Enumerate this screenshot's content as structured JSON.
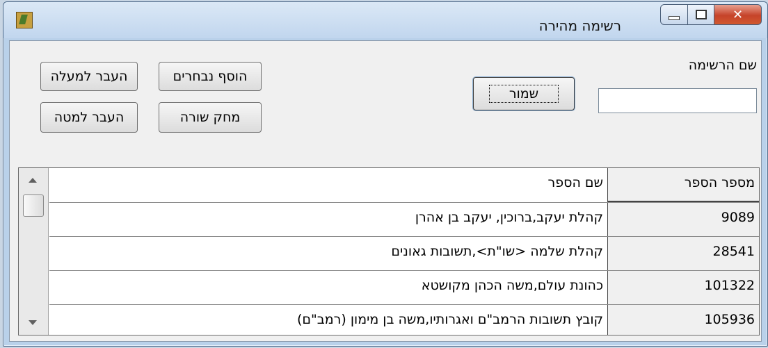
{
  "window": {
    "title": "רשימה מהירה"
  },
  "caption_icons": [
    "minimize-icon",
    "maximize-icon",
    "close-icon"
  ],
  "form": {
    "list_name_label": "שם הרשימה",
    "list_name_value": "",
    "save_button": "שמור",
    "add_selected_button": "הוסף נבחרים",
    "move_up_button": "העבר למעלה",
    "delete_row_button": "מחק שורה",
    "move_down_button": "העבר למטה"
  },
  "table": {
    "columns": [
      "מספר הספר",
      "שם הספר"
    ],
    "rows": [
      {
        "number": "9089",
        "name": "קהלת יעקב,ברוכין, יעקב בן אהרן"
      },
      {
        "number": "28541",
        "name": "קהלת שלמה <שו\"ת>,תשובות גאונים"
      },
      {
        "number": "101322",
        "name": "כהונת עולם,משה הכהן מקושטא"
      },
      {
        "number": "105936",
        "name": "קובץ תשובות הרמב\"ם ואגרותיו,משה בן מימון (רמב\"ם)"
      }
    ]
  }
}
